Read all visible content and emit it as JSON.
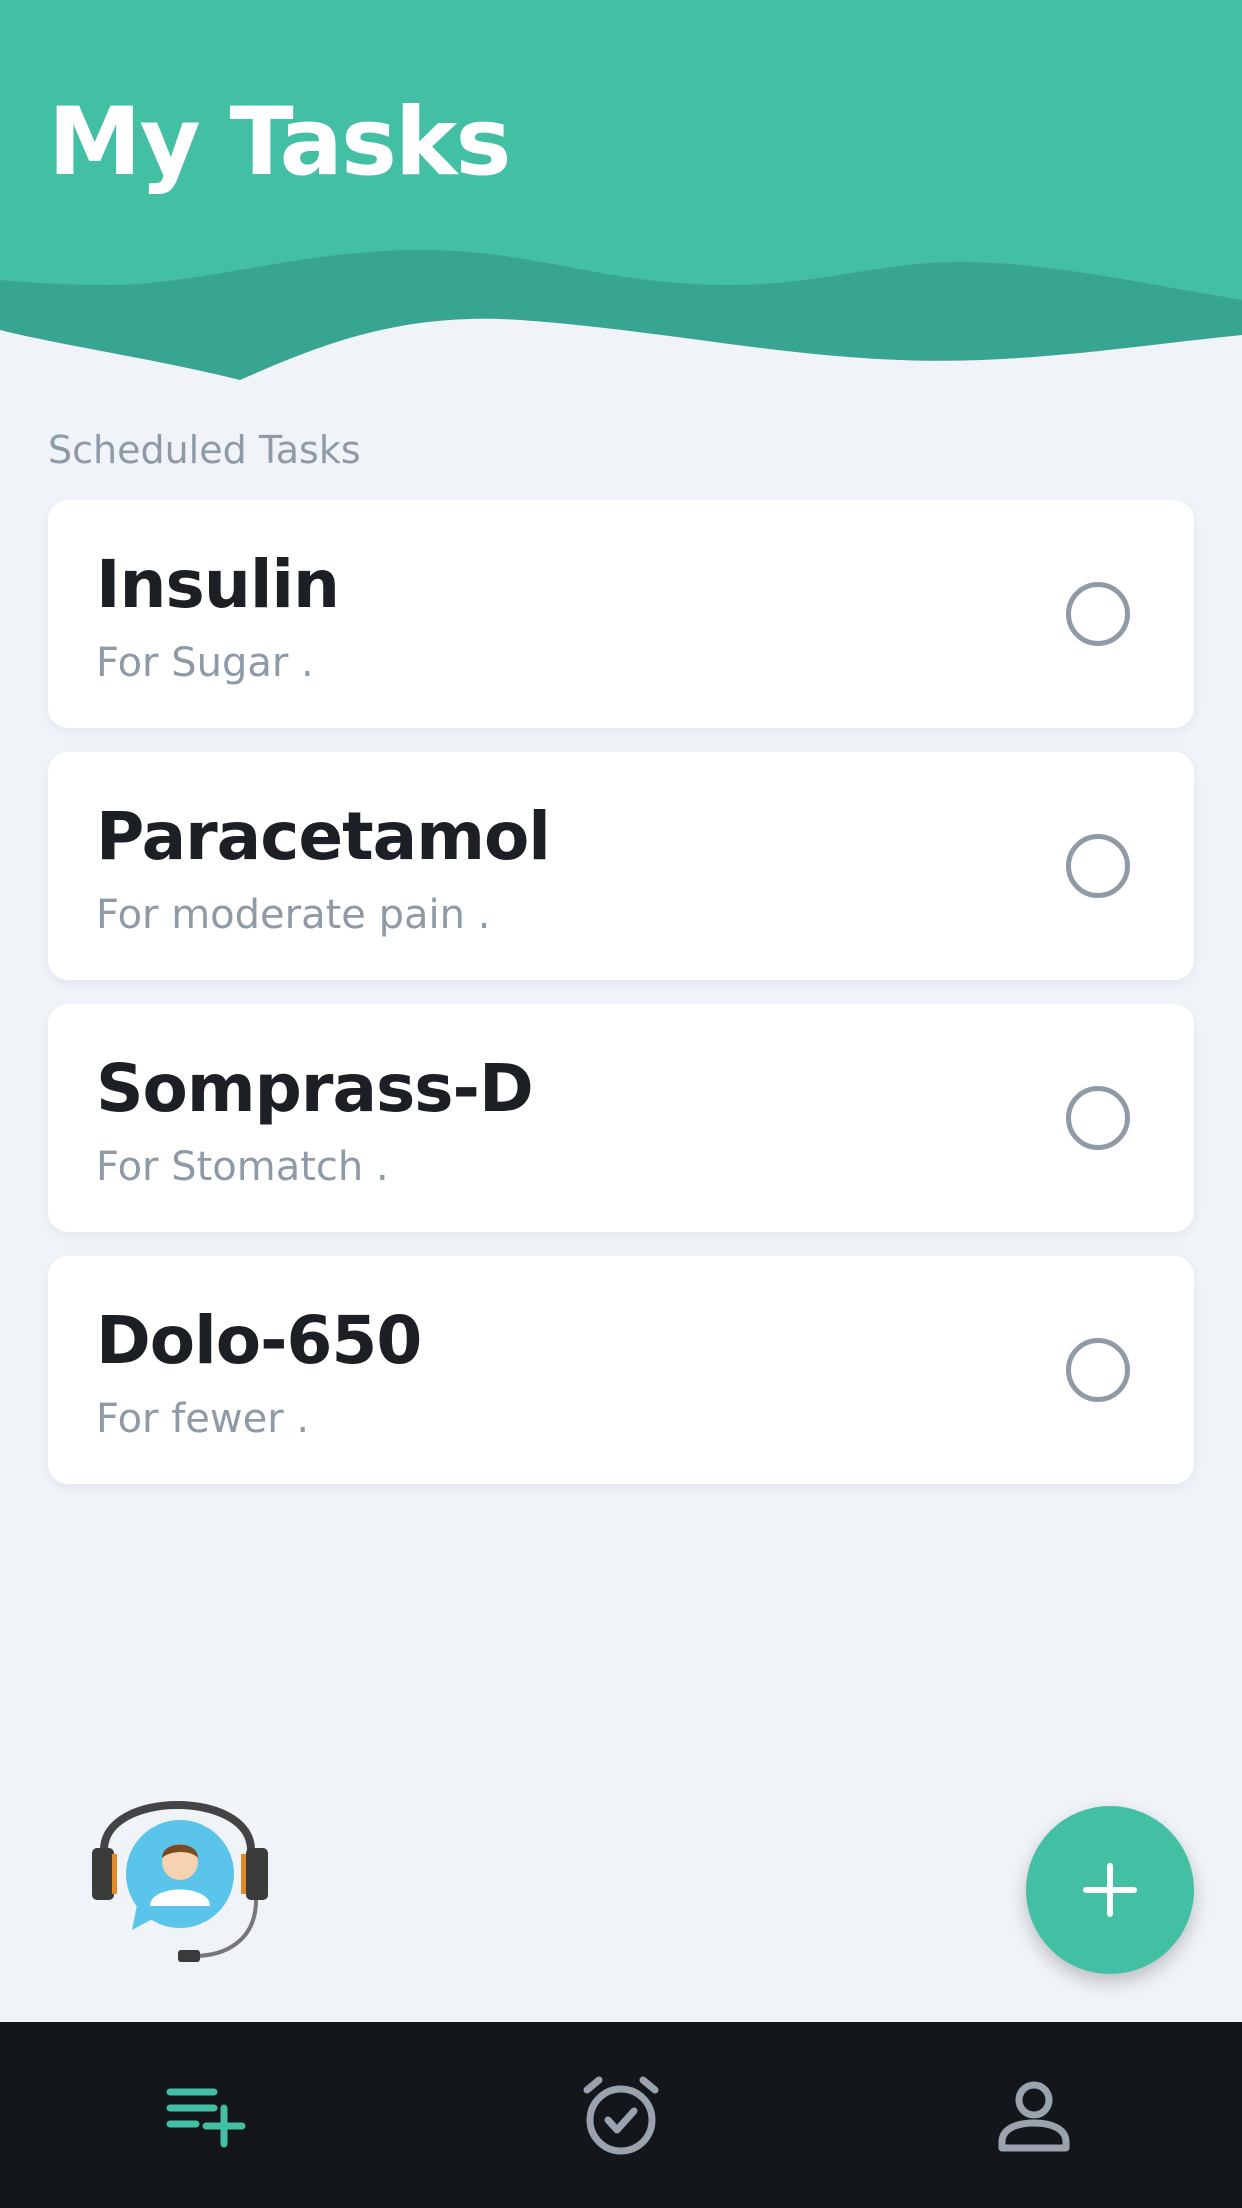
{
  "header": {
    "title": "My Tasks",
    "accent_color": "#43bfa3",
    "wave_color": "#37a58f"
  },
  "section": {
    "label": "Scheduled Tasks"
  },
  "tasks": [
    {
      "name": "Insulin",
      "description": "For Sugar  .",
      "done": false
    },
    {
      "name": "Paracetamol",
      "description": "For moderate pain  .",
      "done": false
    },
    {
      "name": "Somprass-D",
      "description": "For Stomatch   .",
      "done": false
    },
    {
      "name": "Dolo-650",
      "description": "For fewer  .",
      "done": false
    }
  ],
  "support": {
    "icon": "customer-support-icon"
  },
  "fab": {
    "icon": "plus-icon"
  },
  "bottom_nav": {
    "items": [
      {
        "icon": "playlist-add-icon",
        "active": true
      },
      {
        "icon": "alarm-check-icon",
        "active": false
      },
      {
        "icon": "person-icon",
        "active": false
      }
    ],
    "active_color": "#43bfa3",
    "inactive_color": "#9aa3ad",
    "background": "#13171b"
  }
}
